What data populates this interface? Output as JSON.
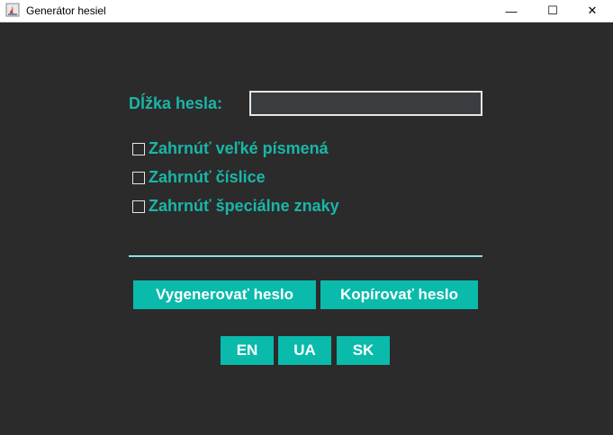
{
  "window": {
    "title": "Generátor hesiel",
    "minimize_glyph": "—",
    "maximize_glyph": "☐",
    "close_glyph": "✕",
    "icon": "java-app-icon"
  },
  "form": {
    "length_label": "Dĺžka hesla:",
    "length_value": "",
    "options": [
      {
        "label": "Zahrnúť veľké písmená",
        "checked": false
      },
      {
        "label": "Zahrnúť číslice",
        "checked": false
      },
      {
        "label": "Zahrnúť špeciálne znaky",
        "checked": false
      }
    ],
    "result": ""
  },
  "buttons": {
    "generate": "Vygenerovať heslo",
    "copy": "Kopírovať heslo"
  },
  "languages": [
    "EN",
    "UA",
    "SK"
  ],
  "colors": {
    "background": "#2b2b2b",
    "accent": "#1ab6a7",
    "button": "#0abaab",
    "button_text": "#ffffff"
  }
}
